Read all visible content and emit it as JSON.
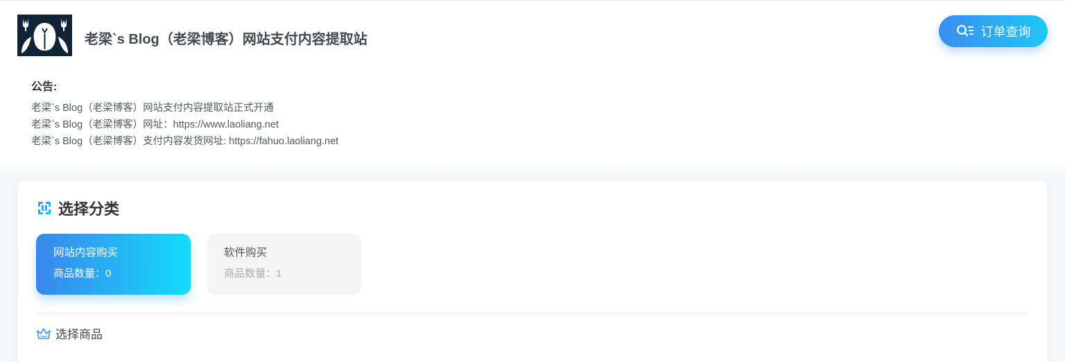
{
  "header": {
    "site_title": "老梁`s Blog（老梁博客）网站支付内容提取站",
    "order_button": {
      "label": "订单查询",
      "icon": "search-list-icon"
    }
  },
  "notice": {
    "title": "公告:",
    "lines": [
      "老梁`s Blog（老梁博客）网站支付内容提取站正式开通",
      "老梁`s Blog（老梁博客）网址：https://www.laoliang.net",
      "老梁`s Blog（老梁博客）支付内容发货网址: https://fahuo.laoliang.net"
    ]
  },
  "categories_section": {
    "title": "选择分类",
    "icon": "category-grid-icon",
    "items": [
      {
        "name": "网站内容购买",
        "count_label": "商品数量：0",
        "selected": true
      },
      {
        "name": "软件购买",
        "count_label": "商品数量：1",
        "selected": false
      }
    ]
  },
  "products_section": {
    "title": "选择商品",
    "icon": "crown-icon"
  },
  "colors": {
    "accent_start": "#3a86ee",
    "accent_end": "#14dcfa",
    "logo_bg": "#0f2537"
  }
}
